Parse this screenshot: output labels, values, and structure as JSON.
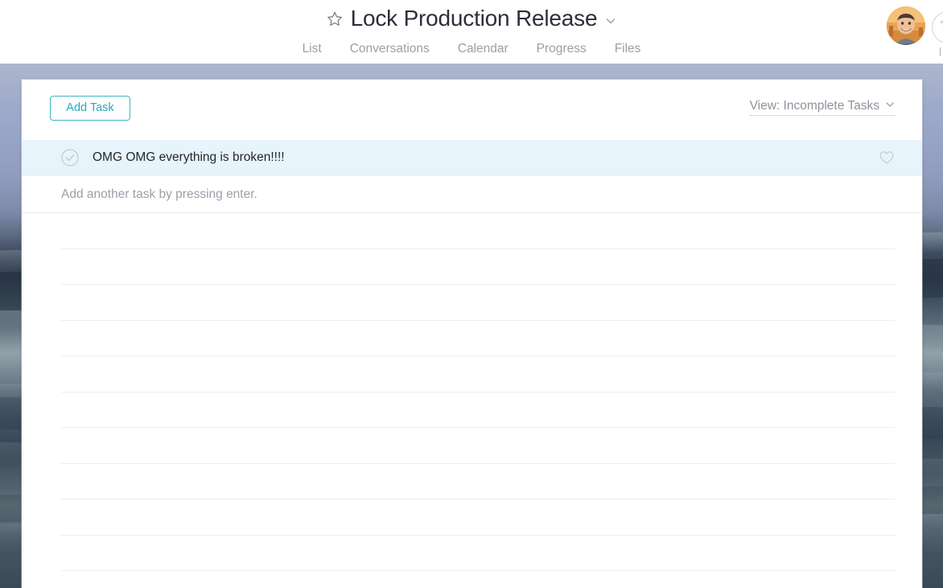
{
  "topbar": {
    "star_icon": "star-outline-icon",
    "project_title": "Lock Production Release",
    "title_chevron_icon": "chevron-down-icon",
    "tabs": [
      {
        "label": "List",
        "name": "tab-list"
      },
      {
        "label": "Conversations",
        "name": "tab-conversations"
      },
      {
        "label": "Calendar",
        "name": "tab-calendar"
      },
      {
        "label": "Progress",
        "name": "tab-progress"
      },
      {
        "label": "Files",
        "name": "tab-files"
      }
    ],
    "avatar_name": "user-avatar",
    "secondary_avatar_glyph": "?",
    "edge_label": "|"
  },
  "toolbar": {
    "add_task_label": "Add Task",
    "view_label": "View: Incomplete Tasks",
    "view_chevron_icon": "chevron-down-icon"
  },
  "tasks": [
    {
      "title": "OMG OMG everything is broken!!!!",
      "completed": false,
      "checkbox_icon": "check-circle-icon",
      "favorite_icon": "heart-outline-icon",
      "highlighted": true
    }
  ],
  "add_row": {
    "placeholder": "Add another task by pressing enter."
  },
  "empty_row_count": 10,
  "colors": {
    "accent_teal": "#2aa8bb",
    "accent_border": "#3fb5c4",
    "row_highlight": "#e7f4fb",
    "text_primary": "#23272e",
    "text_muted": "#9aa0a8",
    "divider": "#eceded",
    "card_bg": "#ffffff"
  }
}
